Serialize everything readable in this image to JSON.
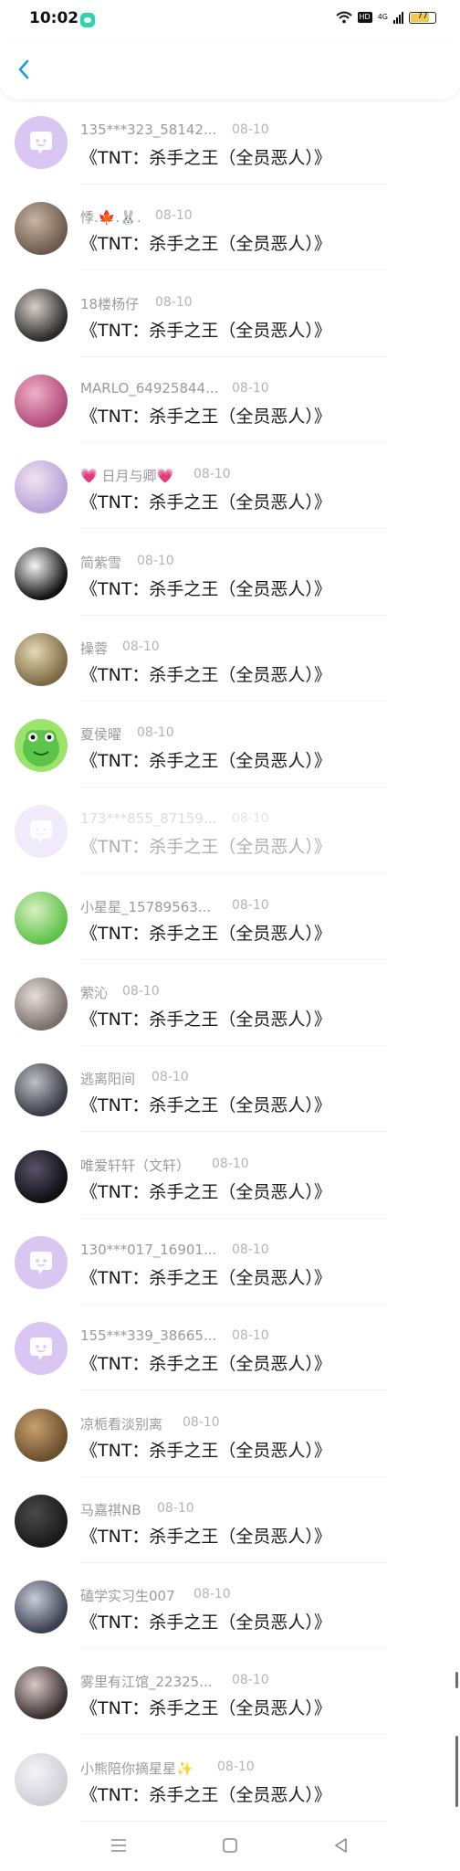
{
  "status_bar": {
    "time": "10:02",
    "hd": "HD",
    "network": "4G",
    "battery": "77"
  },
  "header": {
    "back_icon": "chevron-left-icon",
    "accent": "#1a9ae6"
  },
  "rows": [
    {
      "name": "135***323_58142...",
      "date": "08-10",
      "title": "《TNT：杀手之王（全员恶人）》",
      "avatar": "default-chat",
      "faded": false
    },
    {
      "name": "悸.🍁.🐰.",
      "date": "08-10",
      "title": "《TNT：杀手之王（全员恶人）》",
      "avatar": "photo",
      "faded": false
    },
    {
      "name": "18楼杨仔",
      "date": "08-10",
      "title": "《TNT：杀手之王（全员恶人）》",
      "avatar": "photo",
      "faded": false
    },
    {
      "name": "MARLO_64925844...",
      "date": "08-10",
      "title": "《TNT：杀手之王（全员恶人）》",
      "avatar": "photo",
      "faded": false
    },
    {
      "name": "💗 日月与卿💗",
      "date": "08-10",
      "title": "《TNT：杀手之王（全员恶人）》",
      "avatar": "photo",
      "faded": false
    },
    {
      "name": "简紫雪",
      "date": "08-10",
      "title": "《TNT：杀手之王（全员恶人）》",
      "avatar": "photo",
      "faded": false
    },
    {
      "name": "操蓉",
      "date": "08-10",
      "title": "《TNT：杀手之王（全员恶人）》",
      "avatar": "photo",
      "faded": false
    },
    {
      "name": "夏侯曜",
      "date": "08-10",
      "title": "《TNT：杀手之王（全员恶人）》",
      "avatar": "frog",
      "faded": false
    },
    {
      "name": "173***855_87159...",
      "date": "08-10",
      "title": "《TNT：杀手之王（全员恶人）》",
      "avatar": "default-chat",
      "faded": true
    },
    {
      "name": "小星星_15789563...",
      "date": "08-10",
      "title": "《TNT：杀手之王（全员恶人）》",
      "avatar": "photo",
      "faded": false
    },
    {
      "name": "萦沁",
      "date": "08-10",
      "title": "《TNT：杀手之王（全员恶人）》",
      "avatar": "photo",
      "faded": false
    },
    {
      "name": "逃离阳间",
      "date": "08-10",
      "title": "《TNT：杀手之王（全员恶人）》",
      "avatar": "photo",
      "faded": false
    },
    {
      "name": "唯爱轩轩（文轩）",
      "date": "08-10",
      "title": "《TNT：杀手之王（全员恶人）》",
      "avatar": "photo",
      "faded": false
    },
    {
      "name": "130***017_16901...",
      "date": "08-10",
      "title": "《TNT：杀手之王（全员恶人）》",
      "avatar": "default-chat",
      "faded": false
    },
    {
      "name": "155***339_38665...",
      "date": "08-10",
      "title": "《TNT：杀手之王（全员恶人）》",
      "avatar": "default-chat",
      "faded": false
    },
    {
      "name": "凉栀看淡别离",
      "date": "08-10",
      "title": "《TNT：杀手之王（全员恶人）》",
      "avatar": "photo",
      "faded": false
    },
    {
      "name": "马嘉祺NB",
      "date": "08-10",
      "title": "《TNT：杀手之王（全员恶人）》",
      "avatar": "photo",
      "faded": false
    },
    {
      "name": "磕学实习生007",
      "date": "08-10",
      "title": "《TNT：杀手之王（全员恶人）》",
      "avatar": "photo",
      "faded": false
    },
    {
      "name": "雾里有江馆_22325...",
      "date": "08-10",
      "title": "《TNT：杀手之王（全员恶人）》",
      "avatar": "photo",
      "faded": false
    },
    {
      "name": "小熊陪你摘星星✨",
      "date": "08-10",
      "title": "《TNT：杀手之王（全员恶人）》",
      "avatar": "photo",
      "faded": false
    }
  ],
  "system_nav": {
    "menu_icon": "menu-icon",
    "home_icon": "home-square-icon",
    "back_icon": "back-triangle-icon"
  }
}
